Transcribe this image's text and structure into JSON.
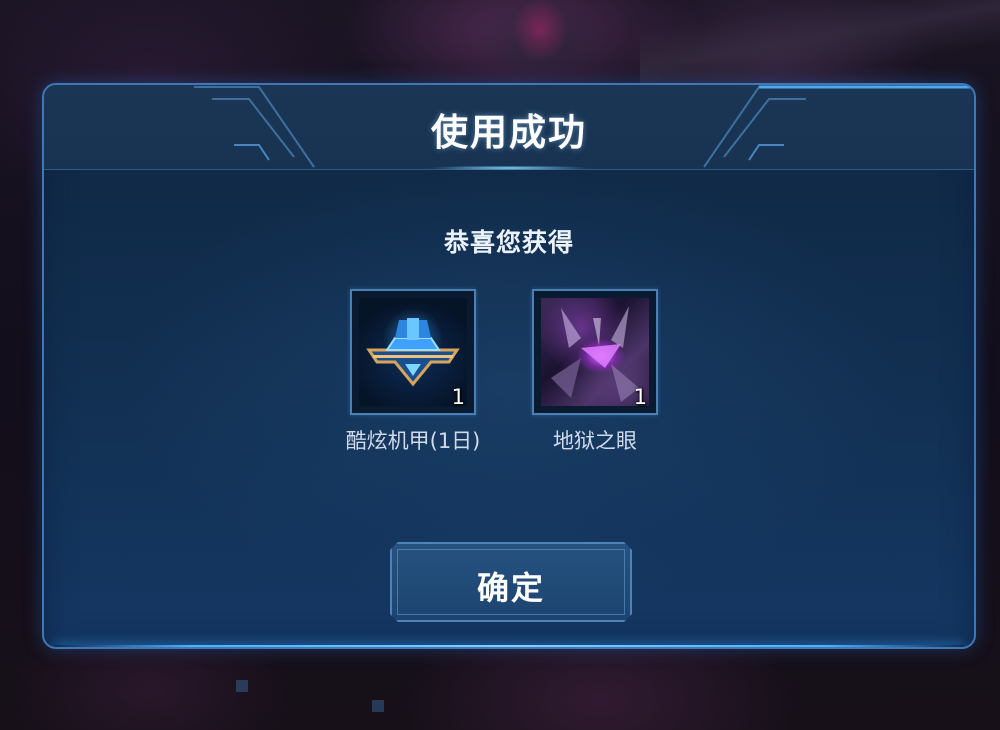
{
  "dialog": {
    "title": "使用成功",
    "subtitle": "恭喜您获得",
    "confirm_label": "确定"
  },
  "rewards": [
    {
      "name": "酷炫机甲(1日)",
      "count": "1",
      "icon": "mecha-emblem-icon"
    },
    {
      "name": "地狱之眼",
      "count": "1",
      "icon": "hell-eye-portrait"
    }
  ],
  "colors": {
    "panel_border": "#3f78b4",
    "panel_bg": "#123052",
    "accent_glow": "#4ab0ff",
    "text_primary": "#ffffff",
    "text_secondary": "#cfdaea"
  }
}
